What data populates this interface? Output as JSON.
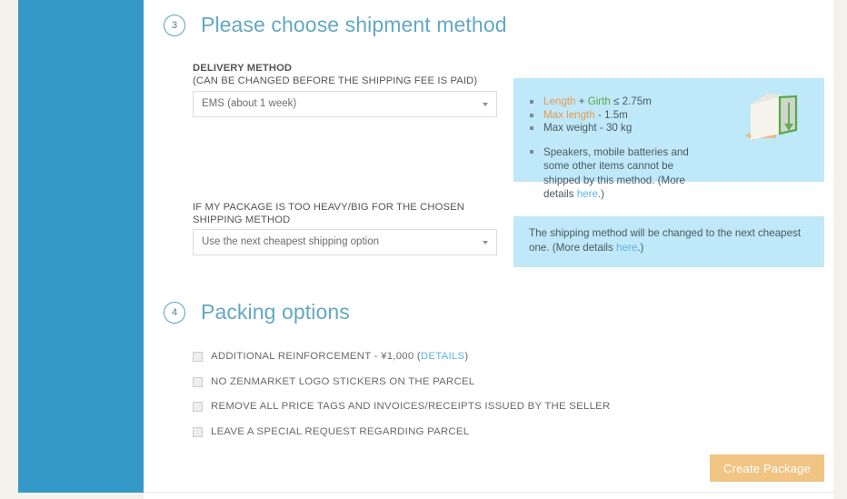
{
  "theme": {
    "sidebar_color": "#3498c9",
    "page_bg": "#f2f1ea",
    "panel_bg": "#ffffff",
    "heading_color": "#62a8c4",
    "info_box_bg": "#bfe8f8",
    "link_color": "#5cb6de",
    "button_bg": "#f0c483",
    "accent_orange": "#e49b55",
    "accent_green": "#57a84a"
  },
  "shipment_section": {
    "step_number": "3",
    "title": "Please choose shipment method",
    "delivery_method": {
      "label_main": "DELIVERY METHOD",
      "label_sub": "(CAN BE CHANGED BEFORE THE SHIPPING FEE IS PAID)",
      "selected": "EMS (about 1 week)"
    },
    "info_box": {
      "bullet1_prefix": "Length",
      "bullet1_plus": " + ",
      "bullet1_girth": "Girth",
      "bullet1_suffix": " ≤ 2.75m",
      "bullet2_label": "Max length",
      "bullet2_value": " -  1.5m",
      "bullet3": "Max weight - 30 kg",
      "bullet4_text": "Speakers, mobile batteries and some other items cannot be shipped by this method. (More details ",
      "bullet4_link": "here",
      "bullet4_tail": ".)"
    },
    "overweight": {
      "label": "IF MY PACKAGE IS TOO HEAVY/BIG FOR THE CHOSEN SHIPPING METHOD",
      "selected": "Use the next cheapest shipping option",
      "info_text": "The shipping method will be changed to the next cheapest one. (More details ",
      "info_link": "here",
      "info_tail": ".)"
    }
  },
  "packing_section": {
    "step_number": "4",
    "title": "Packing options",
    "options": [
      {
        "label": "ADDITIONAL REINFORCEMENT - ¥1,000 (",
        "link": "DETAILS",
        "tail": ")",
        "checked": false
      },
      {
        "label": "NO ZENMARKET LOGO STICKERS ON THE PARCEL",
        "link": "",
        "tail": "",
        "checked": false
      },
      {
        "label": "REMOVE ALL PRICE TAGS AND INVOICES/RECEIPTS ISSUED BY THE SELLER",
        "link": "",
        "tail": "",
        "checked": false
      },
      {
        "label": "LEAVE A SPECIAL REQUEST REGARDING PARCEL",
        "link": "",
        "tail": "",
        "checked": false
      }
    ]
  },
  "footer": {
    "create_button": "Create Package"
  }
}
